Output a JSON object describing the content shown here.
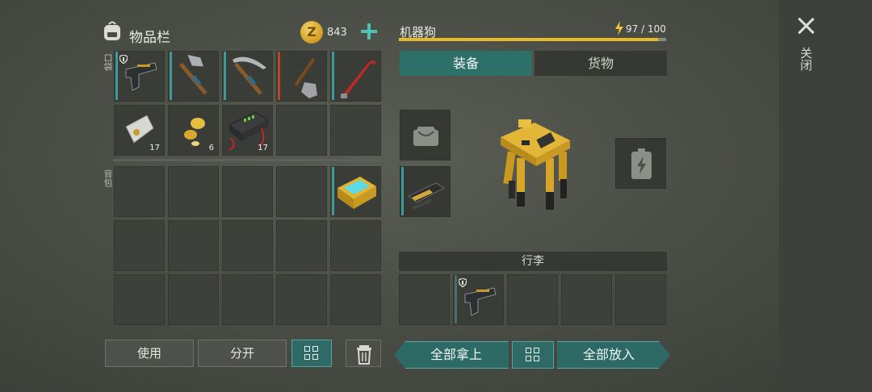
{
  "inventory": {
    "title": "物品栏",
    "coin_symbol": "Z",
    "coin_amount": "843",
    "pocket_label": "口袋",
    "backpack_label": "背包",
    "pocket_items": [
      {
        "name": "pistol",
        "qty": ""
      },
      {
        "name": "hatchet",
        "qty": ""
      },
      {
        "name": "pickaxe",
        "qty": ""
      },
      {
        "name": "shovel",
        "qty": ""
      },
      {
        "name": "crowbar",
        "qty": ""
      },
      {
        "name": "battery-pack",
        "qty": "17"
      },
      {
        "name": "gold-nuggets",
        "qty": "6"
      },
      {
        "name": "car-battery",
        "qty": "17"
      }
    ],
    "backpack_items": [
      {
        "name": "energy-cell-crate",
        "qty": ""
      }
    ]
  },
  "buttons": {
    "use": "使用",
    "split": "分开",
    "take_all": "全部拿上",
    "put_all": "全部放入"
  },
  "robot_dog": {
    "name": "机器狗",
    "energy_text": "97 / 100",
    "energy_fraction": 0.97,
    "tabs": [
      "装备",
      "货物"
    ],
    "luggage_label": "行李",
    "luggage_items": [
      {
        "name": "pistol",
        "qty": ""
      }
    ]
  },
  "close_label": "关闭",
  "colors": {
    "accent_teal": "#2d6f69",
    "energy_yellow": "#e8b92a",
    "coin_gold": "#d19b20"
  }
}
